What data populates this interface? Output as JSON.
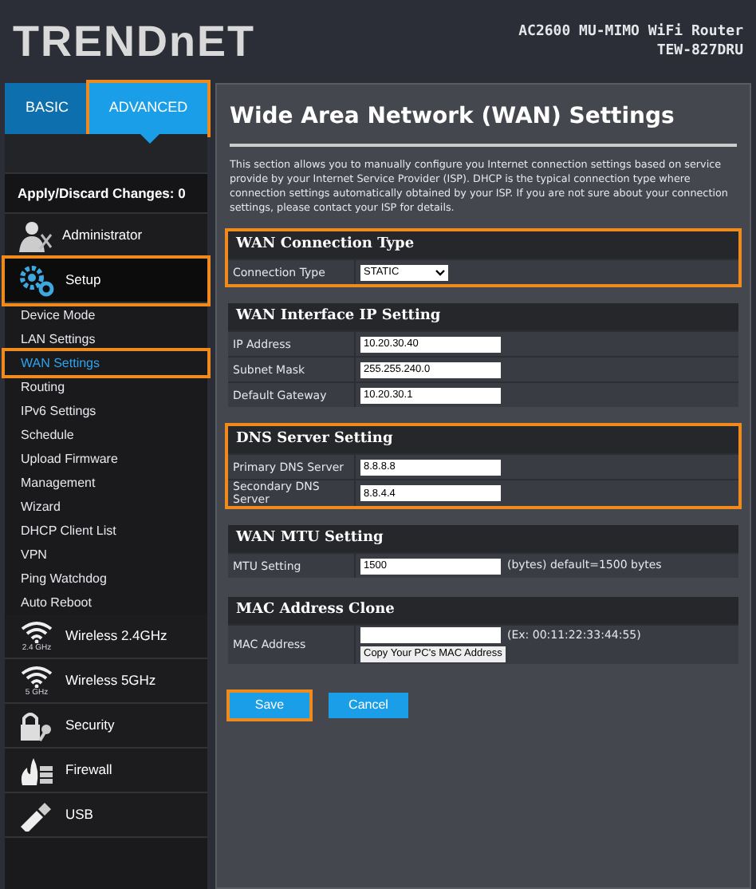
{
  "header": {
    "logo": "TRENDnET",
    "product": "AC2600 MU-MIMO WiFi Router",
    "model": "TEW-827DRU"
  },
  "tabs": [
    {
      "label": "BASIC",
      "selected": false,
      "highlighted": false
    },
    {
      "label": "ADVANCED",
      "selected": true,
      "highlighted": true
    }
  ],
  "apply_label": "Apply/Discard Changes: 0",
  "sidebar": {
    "items": [
      {
        "kind": "group",
        "label": "Administrator",
        "selected": false,
        "highlighted": false
      },
      {
        "kind": "group",
        "label": "Setup",
        "selected": true,
        "highlighted": true
      },
      {
        "kind": "link",
        "label": "Device Mode",
        "selected": false,
        "highlighted": false
      },
      {
        "kind": "link",
        "label": "LAN Settings",
        "selected": false,
        "highlighted": false
      },
      {
        "kind": "link",
        "label": "WAN Settings",
        "selected": true,
        "highlighted": true
      },
      {
        "kind": "link",
        "label": "Routing",
        "selected": false,
        "highlighted": false
      },
      {
        "kind": "link",
        "label": "IPv6 Settings",
        "selected": false,
        "highlighted": false
      },
      {
        "kind": "link",
        "label": "Schedule",
        "selected": false,
        "highlighted": false
      },
      {
        "kind": "link",
        "label": "Upload Firmware",
        "selected": false,
        "highlighted": false
      },
      {
        "kind": "link",
        "label": "Management",
        "selected": false,
        "highlighted": false
      },
      {
        "kind": "link",
        "label": "Wizard",
        "selected": false,
        "highlighted": false
      },
      {
        "kind": "link",
        "label": "DHCP Client List",
        "selected": false,
        "highlighted": false
      },
      {
        "kind": "link",
        "label": "VPN",
        "selected": false,
        "highlighted": false
      },
      {
        "kind": "link",
        "label": "Ping Watchdog",
        "selected": false,
        "highlighted": false
      },
      {
        "kind": "link",
        "label": "Auto Reboot",
        "selected": false,
        "highlighted": false
      },
      {
        "kind": "group",
        "label": "Wireless 2.4GHz",
        "icon_caption": "2.4 GHz",
        "selected": false,
        "highlighted": false
      },
      {
        "kind": "group",
        "label": "Wireless 5GHz",
        "icon_caption": "5 GHz",
        "selected": false,
        "highlighted": false
      },
      {
        "kind": "group",
        "label": "Security",
        "selected": false,
        "highlighted": false
      },
      {
        "kind": "group",
        "label": "Firewall",
        "selected": false,
        "highlighted": false
      },
      {
        "kind": "group",
        "label": "USB",
        "selected": false,
        "highlighted": false
      }
    ]
  },
  "main": {
    "title": "Wide Area Network (WAN) Settings",
    "intro": "This section allows you to manually configure you Internet connection settings based on service provide by your Internet Service Provider (ISP). DHCP is the typical connection type where connection settings automatically obtained by your ISP. If you are not sure about your connection settings, please contact your ISP for details.",
    "sections": [
      {
        "title": "WAN Connection Type",
        "highlighted": true,
        "rows": [
          {
            "label": "Connection Type",
            "kind": "select",
            "value": "STATIC"
          }
        ]
      },
      {
        "title": "WAN Interface IP Setting",
        "highlighted": false,
        "rows": [
          {
            "label": "IP Address",
            "kind": "input",
            "value": "10.20.30.40"
          },
          {
            "label": "Subnet Mask",
            "kind": "input",
            "value": "255.255.240.0"
          },
          {
            "label": "Default Gateway",
            "kind": "input",
            "value": "10.20.30.1"
          }
        ]
      },
      {
        "title": "DNS Server Setting",
        "highlighted": true,
        "rows": [
          {
            "label": "Primary DNS Server",
            "kind": "input",
            "value": "8.8.8.8"
          },
          {
            "label": "Secondary DNS Server",
            "kind": "input",
            "value": "8.8.4.4"
          }
        ]
      },
      {
        "title": "WAN MTU Setting",
        "highlighted": false,
        "rows": [
          {
            "label": "MTU Setting",
            "kind": "input",
            "value": "1500",
            "note": "(bytes) default=1500 bytes"
          }
        ]
      },
      {
        "title": "MAC Address Clone",
        "highlighted": false,
        "rows": [
          {
            "label": "MAC Address",
            "kind": "input",
            "note": "(Ex: 00:11:22:33:44:55)",
            "button": "Copy Your PC's MAC Address"
          }
        ]
      }
    ],
    "buttons": [
      {
        "label": "Save",
        "highlighted": true
      },
      {
        "label": "Cancel",
        "highlighted": false
      }
    ]
  }
}
